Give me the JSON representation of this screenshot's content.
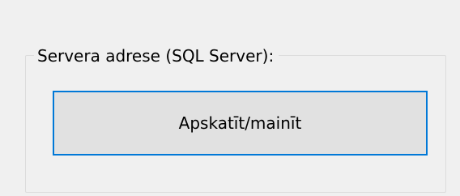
{
  "server_group": {
    "title": "Servera adrese (SQL Server):",
    "button_label": "Apskatīt/mainīt"
  },
  "colors": {
    "background": "#f0f0f0",
    "group_border": "#dcdcdc",
    "button_face": "#e1e1e1",
    "button_focus_border": "#0078d7",
    "text": "#000000"
  }
}
